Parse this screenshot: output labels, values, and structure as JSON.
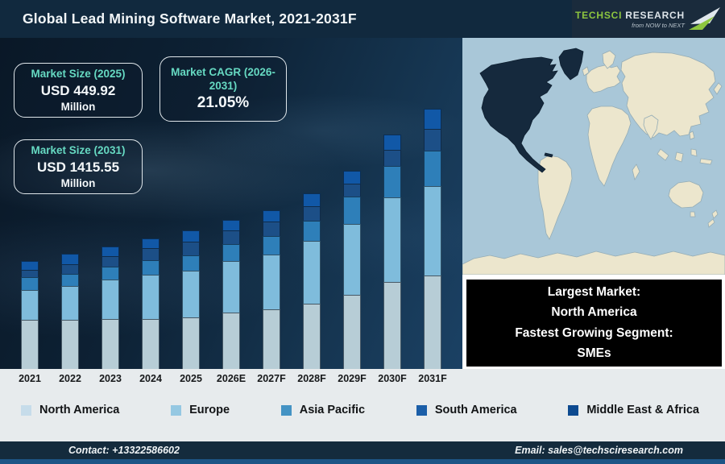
{
  "header": {
    "title": "Global Lead Mining Software Market, 2021-2031F",
    "logo": {
      "brand": "TechSci",
      "brand2": "Research",
      "tagline": "from NOW to NEXT"
    }
  },
  "callouts": {
    "size_2025": {
      "label": "Market Size (2025)",
      "value": "USD 449.92",
      "unit": "Million"
    },
    "cagr": {
      "label": "Market CAGR (2026-2031)",
      "value": "21.05%"
    },
    "size_2031": {
      "label": "Market Size (2031)",
      "value": "USD 1415.55",
      "unit": "Million"
    }
  },
  "chart_data": {
    "type": "bar",
    "stacked": true,
    "title": "Global Lead Mining Software Market, 2021-2031F",
    "categories": [
      "2021",
      "2022",
      "2023",
      "2024",
      "2025",
      "2026E",
      "2027F",
      "2028F",
      "2029F",
      "2030F",
      "2031F"
    ],
    "series": [
      {
        "name": "North America",
        "color": "#b7cdd6",
        "swatch": "#c6dcea",
        "values": [
          62,
          62,
          63,
          63,
          65,
          71,
          75,
          82,
          93,
          109,
          117
        ]
      },
      {
        "name": "Europe",
        "color": "#7fbcdc",
        "swatch": "#95c8e2",
        "values": [
          37,
          42,
          49,
          55,
          58,
          64,
          68,
          78,
          88,
          105,
          111
        ]
      },
      {
        "name": "Asia Pacific",
        "color": "#2e7fb9",
        "swatch": "#4493c4",
        "values": [
          16,
          15,
          16,
          18,
          19,
          21,
          23,
          25,
          34,
          39,
          44
        ]
      },
      {
        "name": "South America",
        "color": "#1c4f87",
        "swatch": "#1b5ea8",
        "values": [
          9,
          12,
          13,
          15,
          17,
          17,
          18,
          18,
          16,
          20,
          27
        ]
      },
      {
        "name": "Middle East & Africa",
        "color": "#1158a7",
        "swatch": "#0d4a90",
        "values": [
          11,
          13,
          12,
          12,
          14,
          13,
          14,
          16,
          16,
          19,
          25
        ]
      }
    ],
    "value_axis": "none shown (values are rendered bar-segment heights in px; chart is illustrative, no gridlines)",
    "legend_position": "bottom",
    "known_totals": {
      "2025": "USD 449.92 Million",
      "2031F": "USD 1415.55 Million"
    },
    "cagr_2026_2031": "21.05%"
  },
  "map": {
    "highlight_region": "North America",
    "ocean_color": "#a9c7d8",
    "land_color": "#ece6cd",
    "land_stroke": "#94acb5",
    "highlight_color": "#15293d"
  },
  "highlight_box": {
    "lines": [
      "Largest Market:",
      "North America",
      "Fastest Growing Segment:",
      "SMEs"
    ]
  },
  "footer": {
    "contact": "Contact: +13322586602",
    "email": "Email: sales@techsciresearch.com"
  },
  "colors": {
    "topbar": "#11293e",
    "chart_bg": "#0d2033",
    "strip": "#e7ebed",
    "footer": "#142b3d",
    "footer_accent": "#1d5586",
    "teal_accent": "#66d9c2",
    "logo_green": "#8dc63f"
  }
}
